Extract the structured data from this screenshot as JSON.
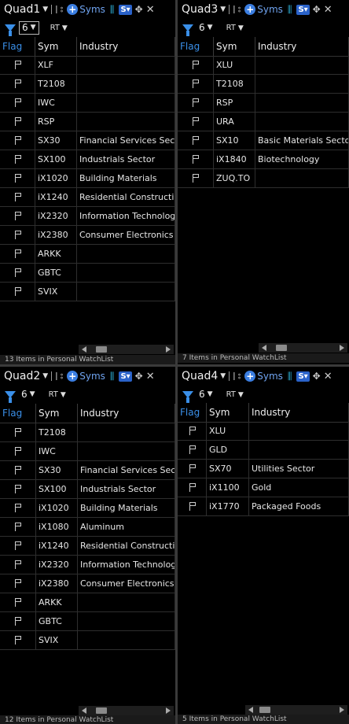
{
  "quads": [
    {
      "title": "Quad1",
      "syms_label": "Syms",
      "filter_count": "6",
      "rt_label": "RT",
      "columns": [
        "Flag",
        "Sym",
        "Industry"
      ],
      "rows": [
        {
          "sym": "XLF",
          "industry": ""
        },
        {
          "sym": "T2108",
          "industry": ""
        },
        {
          "sym": "IWC",
          "industry": ""
        },
        {
          "sym": "RSP",
          "industry": ""
        },
        {
          "sym": "SX30",
          "industry": "Financial Services Sector"
        },
        {
          "sym": "SX100",
          "industry": "Industrials Sector"
        },
        {
          "sym": "iX1020",
          "industry": "Building Materials"
        },
        {
          "sym": "iX1240",
          "industry": "Residential Construction"
        },
        {
          "sym": "iX2320",
          "industry": "Information Technology"
        },
        {
          "sym": "iX2380",
          "industry": "Consumer Electronics"
        },
        {
          "sym": "ARKK",
          "industry": ""
        },
        {
          "sym": "GBTC",
          "industry": ""
        },
        {
          "sym": "SVIX",
          "industry": ""
        }
      ],
      "footer": "13 Items in Personal WatchList"
    },
    {
      "title": "Quad3",
      "syms_label": "Syms",
      "filter_count": "6",
      "rt_label": "RT",
      "columns": [
        "Flag",
        "Sym",
        "Industry"
      ],
      "rows": [
        {
          "sym": "XLU",
          "industry": ""
        },
        {
          "sym": "T2108",
          "industry": ""
        },
        {
          "sym": "RSP",
          "industry": ""
        },
        {
          "sym": "URA",
          "industry": ""
        },
        {
          "sym": "SX10",
          "industry": "Basic Materials Sector"
        },
        {
          "sym": "iX1840",
          "industry": "Biotechnology"
        },
        {
          "sym": "ZUQ.TO",
          "industry": ""
        }
      ],
      "footer": "7 Items in Personal WatchList"
    },
    {
      "title": "Quad2",
      "syms_label": "Syms",
      "filter_count": "6",
      "rt_label": "RT",
      "columns": [
        "Flag",
        "Sym",
        "Industry"
      ],
      "rows": [
        {
          "sym": "T2108",
          "industry": ""
        },
        {
          "sym": "IWC",
          "industry": ""
        },
        {
          "sym": "SX30",
          "industry": "Financial Services Sector"
        },
        {
          "sym": "SX100",
          "industry": "Industrials Sector"
        },
        {
          "sym": "iX1020",
          "industry": "Building Materials"
        },
        {
          "sym": "iX1080",
          "industry": "Aluminum"
        },
        {
          "sym": "iX1240",
          "industry": "Residential Construction"
        },
        {
          "sym": "iX2320",
          "industry": "Information Technology"
        },
        {
          "sym": "iX2380",
          "industry": "Consumer Electronics"
        },
        {
          "sym": "ARKK",
          "industry": ""
        },
        {
          "sym": "GBTC",
          "industry": ""
        },
        {
          "sym": "SVIX",
          "industry": ""
        }
      ],
      "footer": "12 Items in Personal WatchList"
    },
    {
      "title": "Quad4",
      "syms_label": "Syms",
      "filter_count": "6",
      "rt_label": "RT",
      "columns": [
        "Flag",
        "Sym",
        "Industry"
      ],
      "rows": [
        {
          "sym": "XLU",
          "industry": ""
        },
        {
          "sym": "GLD",
          "industry": ""
        },
        {
          "sym": "SX70",
          "industry": "Utilities Sector"
        },
        {
          "sym": "iX1100",
          "industry": "Gold"
        },
        {
          "sym": "iX1770",
          "industry": "Packaged Foods"
        }
      ],
      "footer": "5 Items in Personal WatchList"
    }
  ],
  "colors": {
    "accent": "#3a8fe8",
    "background": "#000000",
    "divider": "#3a3a3a"
  },
  "icons": [
    "flag-icon",
    "filter-icon",
    "add-icon",
    "tv-icon",
    "stockscan-icon",
    "move-icon",
    "close-icon"
  ]
}
